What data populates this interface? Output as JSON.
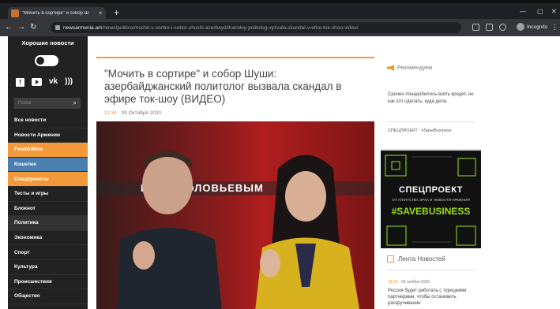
{
  "browser": {
    "tab_title": "\"Мочить в сортире\" и собор Ш",
    "url_domain": "newsarmenia.am",
    "url_path": "/news/politics/mochit-v-sortire-i-sobor-shushi-azerbaydzhanskiy-politolog-vyzvala-skandal-v-efire-tok-shou-video/",
    "profile_label": "Incognito"
  },
  "sidebar": {
    "logo": "Хорошие новости",
    "search_placeholder": "Поиск",
    "menu": [
      {
        "label": "Все новости",
        "bg": "#222222"
      },
      {
        "label": "Новости Армении",
        "bg": "#222222"
      },
      {
        "label": "Food&Wine",
        "bg": "#f29a3a"
      },
      {
        "label": "Кошелек",
        "bg": "#4a7fb0"
      },
      {
        "label": "Спецпроекты",
        "bg": "#f29a3a"
      },
      {
        "label": "Тесты и игры",
        "bg": "#222222"
      },
      {
        "label": "Блокнот",
        "bg": "#222222"
      },
      {
        "label": "Политика",
        "bg": "#333333"
      },
      {
        "label": "Экономика",
        "bg": "#222222"
      },
      {
        "label": "Спорт",
        "bg": "#222222"
      },
      {
        "label": "Культура",
        "bg": "#222222"
      },
      {
        "label": "Происшествия",
        "bg": "#222222"
      },
      {
        "label": "Общество",
        "bg": "#222222"
      }
    ]
  },
  "article": {
    "headline": "\"Мочить в сортире\" и собор Шуши: азербайджанский политолог вызвала скандал в эфире ток-шоу (ВИДЕО)",
    "time": "11:34",
    "date": "09 Октября 2020",
    "chyron": "ИРОМ СОЛОВЬЕВЫМ"
  },
  "right": {
    "recommend_heading": "Рекомендуем",
    "recommend_text": "Срочно понадобилось взять кредит, но как это сделать, куда дела",
    "recommend_sub": "СПЕЦПРОЕКТ - #SaveBusiness",
    "banner": {
      "line1": "СПЕЦПРОЕКТ",
      "line2": "ОТ АГЕНТСТВА ЭРКА И НОВОСТИ-АРМЕНИЯ",
      "line3": "#SAVEBUSINESS"
    },
    "feed_heading": "Лента Новостей",
    "feed_time": "18:30",
    "feed_date": "03 ноября 2020",
    "feed_text": "Россия будет работать с турецкими партнерами, чтобы остановить раскручивание"
  },
  "colors": {
    "accent": "#f29a3a",
    "sidebar_bg": "#222222",
    "banner_green": "#9be01a"
  }
}
